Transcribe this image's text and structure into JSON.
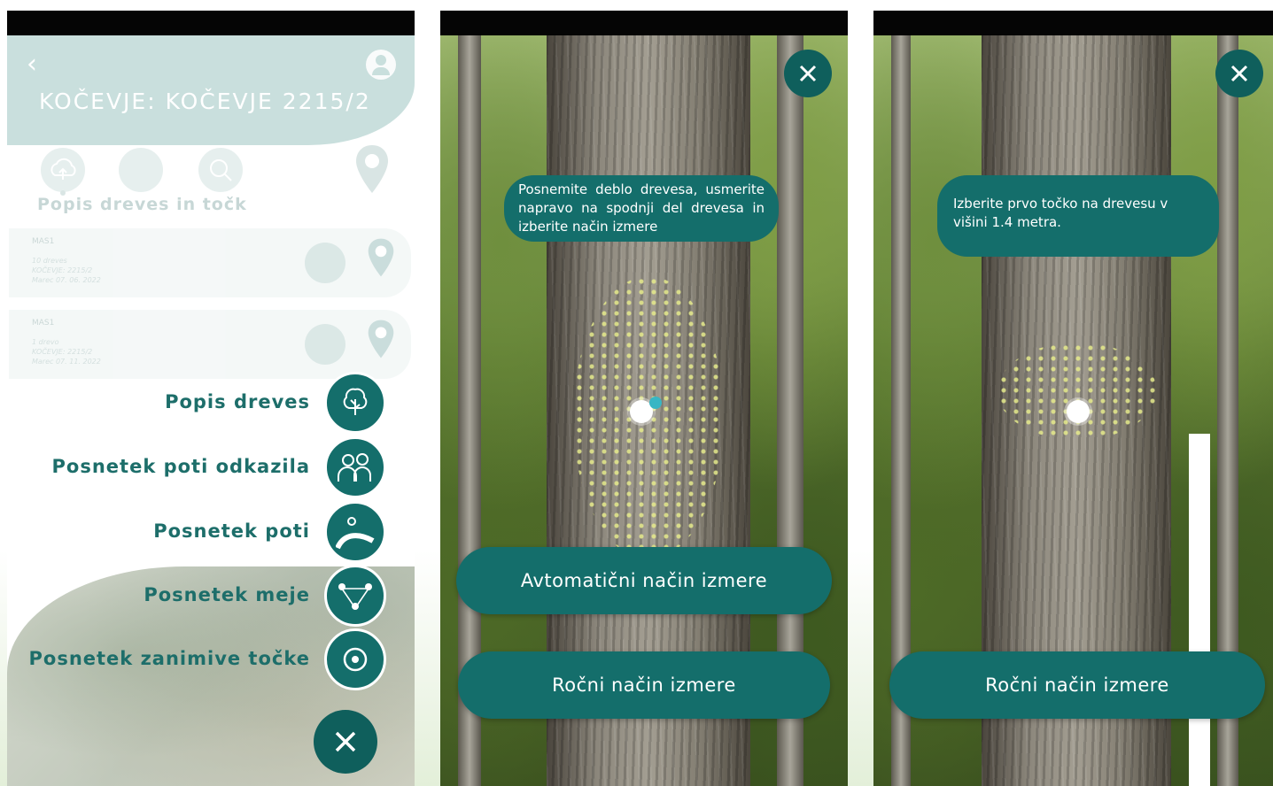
{
  "screen1": {
    "title": "KOČEVJE: KOČEVJE 2215/2",
    "back_icon": "chevron-left-icon",
    "user_icon": "user-icon",
    "tabs_label": "Popis dreves in točk",
    "cards": [
      {
        "title": "MAS1",
        "lines": [
          "10 dreves",
          "KOČEVJE: 2215/2",
          "Marec 07. 06. 2022"
        ]
      },
      {
        "title": "MAS1",
        "lines": [
          "1 drevo",
          "KOČEVJE: 2215/2",
          "Marec 07. 11. 2022"
        ]
      }
    ],
    "menu": [
      {
        "label": "Popis dreves",
        "icon": "tree-icon"
      },
      {
        "label": "Posnetek poti odkazila",
        "icon": "people-icon"
      },
      {
        "label": "Posnetek poti",
        "icon": "path-icon"
      },
      {
        "label": "Posnetek meje",
        "icon": "boundary-icon"
      },
      {
        "label": "Posnetek zanimive točke",
        "icon": "target-icon"
      }
    ],
    "close_icon": "close-icon"
  },
  "screen2": {
    "instruction": "Posnemite deblo drevesa, usmerite napravo na spodnji del drevesa in izberite način izmere",
    "auto_button": "Avtomatični način izmere",
    "manual_button": "Ročni način izmere",
    "close_icon": "close-icon"
  },
  "screen3": {
    "instruction": "Izberite prvo točko na drevesu v višini 1.4 metra.",
    "manual_button": "Ročni način izmere",
    "close_icon": "close-icon"
  },
  "colors": {
    "primary": "#146e6b",
    "header": "#c9dfdd",
    "label": "#1d6e6a"
  }
}
